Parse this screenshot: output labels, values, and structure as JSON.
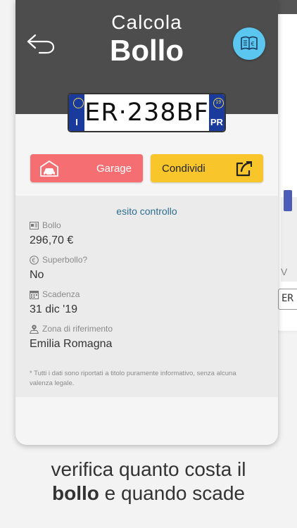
{
  "header": {
    "title_line1": "Calcola",
    "title_line2": "Bollo"
  },
  "plate": {
    "number": "ER·238BF",
    "country_code": "I",
    "province": "PR",
    "year_badge": "19"
  },
  "actions": {
    "garage_label": "Garage",
    "share_label": "Condividi"
  },
  "results": {
    "title": "esito controllo",
    "bollo_label": "Bollo",
    "bollo_value": "296,70 €",
    "superbollo_label": "Superbollo?",
    "superbollo_value": "No",
    "scadenza_label": "Scadenza",
    "scadenza_value": "31 dic '19",
    "zona_label": "Zona di riferimento",
    "zona_value": "Emilia Romagna",
    "disclaimer": "* Tutti i dati sono riportati a titolo puramente informativo, senza alcuna valenza legale."
  },
  "tagline": {
    "part1": "verifica quanto costa il",
    "bold_word": "bollo",
    "part2": " e quando scade"
  },
  "background_phone": {
    "letter": "V",
    "plate_fragment": "ER"
  },
  "colors": {
    "header_bg": "#4d4d4d",
    "accent_blue": "#5bc6ef",
    "garage_red": "#f56f72",
    "share_yellow": "#f8c62a",
    "plate_blue": "#1a3a9c",
    "result_title": "#2e6d8f"
  },
  "icons": {
    "back": "back-arrow-icon",
    "book": "book-euro-icon",
    "garage": "garage-car-icon",
    "share": "share-icon",
    "bollo": "receipt-icon",
    "superbollo": "euro-circle-icon",
    "scadenza": "calendar-icon",
    "zona": "map-pin-icon"
  }
}
